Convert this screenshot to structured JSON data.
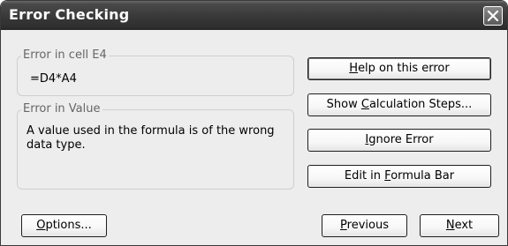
{
  "window": {
    "title": "Error Checking",
    "close_icon": "close-icon"
  },
  "error_cell": {
    "legend": "Error in cell E4",
    "formula": "=D4*A4"
  },
  "error_value": {
    "legend": "Error in Value",
    "message_line1": "A value used in the formula is of the wrong",
    "message_line2": "data type."
  },
  "buttons": {
    "help": {
      "pre": "",
      "key": "H",
      "post": "elp on this error"
    },
    "show_steps": {
      "pre": "Show ",
      "key": "C",
      "post": "alculation Steps..."
    },
    "ignore": {
      "pre": "",
      "key": "I",
      "post": "gnore Error"
    },
    "edit_formula": {
      "pre": "Edit in ",
      "key": "F",
      "post": "ormula Bar"
    },
    "options": {
      "pre": "",
      "key": "O",
      "post": "ptions..."
    },
    "previous": {
      "pre": "",
      "key": "P",
      "post": "revious"
    },
    "next": {
      "pre": "",
      "key": "N",
      "post": "ext"
    }
  },
  "colors": {
    "titlebar": "#3a3a3a",
    "dialog_bg": "#ededed",
    "group_border": "#cfcfcf",
    "legend_text": "#666666"
  }
}
